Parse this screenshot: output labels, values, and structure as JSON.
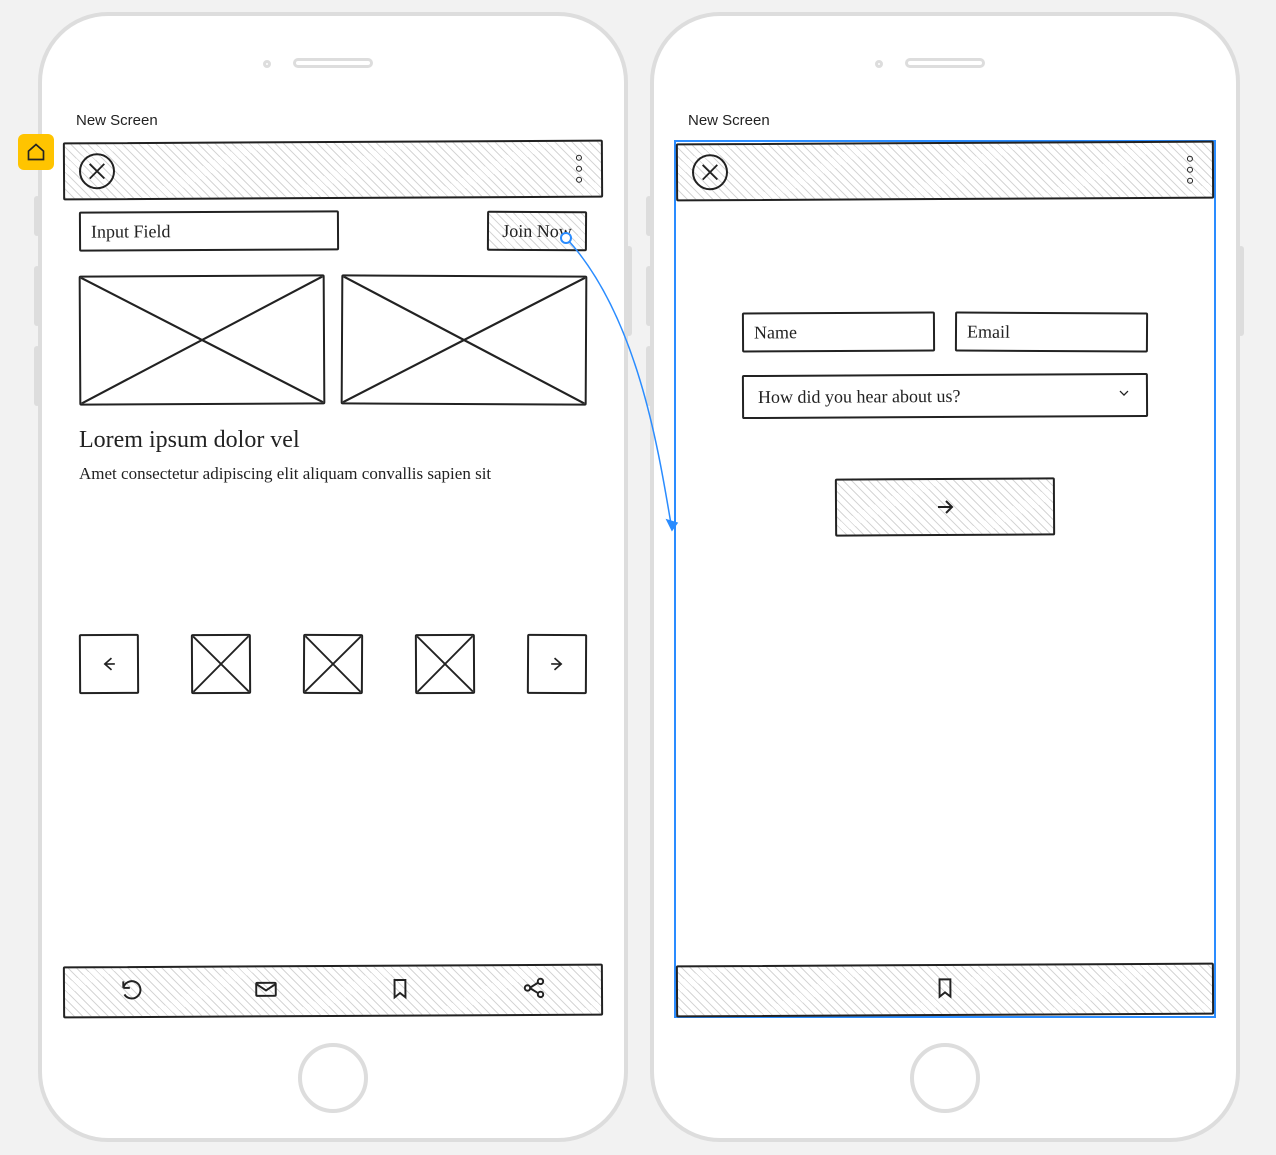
{
  "canvas": {
    "home_badge": "home"
  },
  "screen1": {
    "title": "New Screen",
    "input_placeholder": "Input Field",
    "cta_label": "Join Now",
    "heading": "Lorem ipsum dolor vel",
    "body": "Amet consectetur adipiscing elit aliquam convallis sapien sit",
    "tabs": [
      "refresh",
      "mail",
      "bookmark",
      "share"
    ]
  },
  "screen2": {
    "title": "New Screen",
    "name_placeholder": "Name",
    "email_placeholder": "Email",
    "select_label": "How did you hear about us?",
    "tabs": [
      "bookmark"
    ]
  },
  "link": {
    "from": "screen1.cta",
    "to": "screen2"
  }
}
